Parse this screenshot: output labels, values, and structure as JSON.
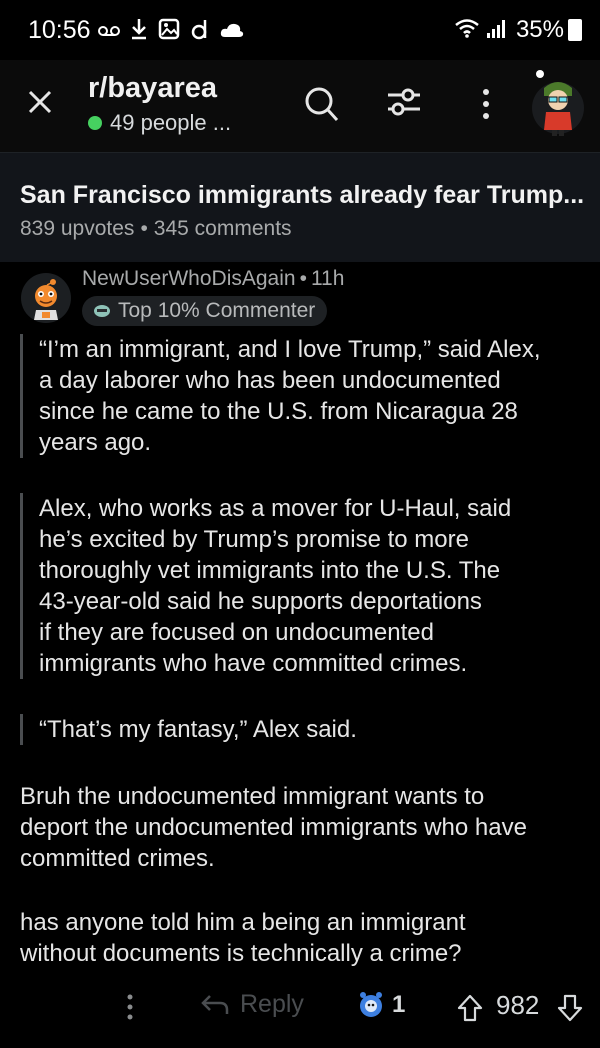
{
  "status_bar": {
    "time": "10:56",
    "battery": "35%",
    "left_icons": [
      "voicemail-icon",
      "download-icon",
      "gallery-icon",
      "d-app-icon",
      "cloud-icon"
    ],
    "right_icons": [
      "wifi-icon",
      "signal-icon",
      "battery-icon"
    ]
  },
  "header": {
    "subreddit": "r/bayarea",
    "online": "49 people ...",
    "online_color": "#46d160",
    "icons": [
      "close-icon",
      "search-icon",
      "filter-icon",
      "more-vertical-icon",
      "avatar"
    ]
  },
  "post": {
    "title": "San Francisco immigrants already fear Trump...",
    "upvotes": "839 upvotes",
    "separator": "•",
    "comments": "345 comments"
  },
  "comment": {
    "author": "NewUserWhoDisAgain",
    "separator": "•",
    "age": "11h",
    "badge": "Top 10% Commenter",
    "quotes": [
      [
        "“I’m an immigrant, and I love Trump,” said Alex,",
        "a day laborer who has been undocumented",
        "since he came to the U.S. from Nicaragua 28",
        "years ago."
      ],
      [
        "Alex, who works as a mover for U-Haul, said",
        "he’s excited by Trump’s promise to more",
        "thoroughly vet immigrants into the U.S. The",
        "43-year-old said he supports deportations",
        "if they are focused on undocumented",
        "immigrants who have committed crimes."
      ],
      [
        "“That’s my fantasy,” Alex said."
      ]
    ],
    "paragraphs": [
      [
        "Bruh the undocumented immigrant wants to",
        "deport the undocumented immigrants who have",
        "committed crimes."
      ],
      [
        "has anyone told him a being an immigrant",
        "without documents is technically a crime?"
      ]
    ],
    "actions": {
      "reply": "Reply",
      "award_count": "1",
      "score": "982"
    }
  },
  "colors": {
    "background": "#000000",
    "header_bg": "#12151a",
    "muted_text": "#a8aaab",
    "quote_bar": "#4a4d50",
    "award": "#3d7fe0"
  }
}
